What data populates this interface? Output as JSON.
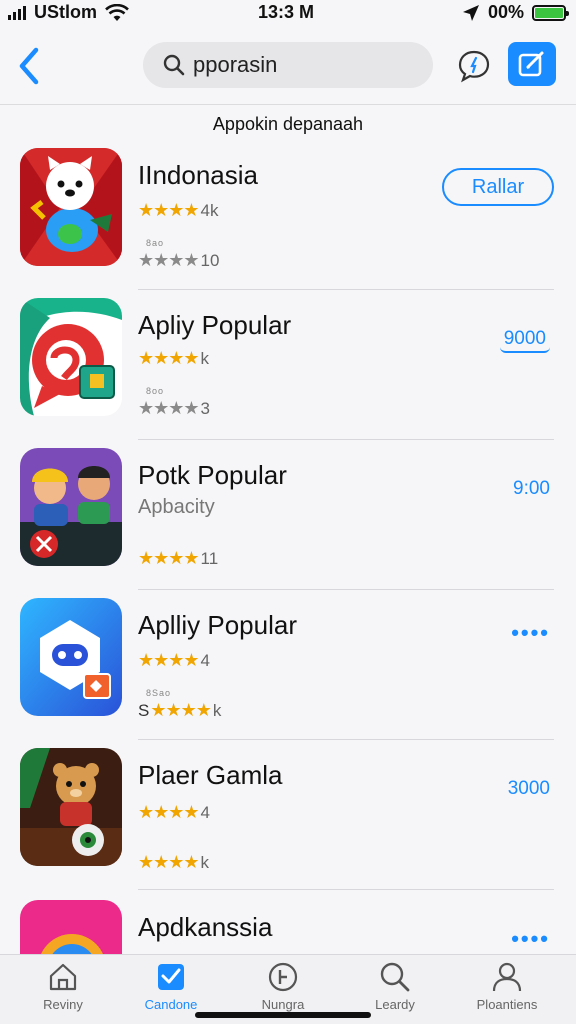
{
  "status_bar": {
    "carrier": "UStlom",
    "time": "13:3 M",
    "battery_pct": "00%"
  },
  "nav": {
    "search_query": "pporasin"
  },
  "section_title": "Appokin depanaah",
  "apps": [
    {
      "name": "IIndonasia",
      "stars_line1": "★★★★",
      "stars_line1_text": "4k",
      "tiny_text": "8ao",
      "stars_line2": "★★★★",
      "stars_line2_text": "10",
      "action": "Rallar",
      "action_style": "pill"
    },
    {
      "name": "Apliy Popular",
      "stars_line1": "★★★★",
      "stars_line1_text": "k",
      "tiny_text": "8oo",
      "stars_line2": "★★★★",
      "stars_line2_text": "3",
      "action": "9000",
      "action_style": "underline"
    },
    {
      "name": "Potk Popular",
      "subtitle": "Apbacity",
      "stars_line2": "★★★★",
      "stars_line2_text": "11",
      "action": "9:00",
      "action_style": "number"
    },
    {
      "name": "Aplliy Popular",
      "stars_line1": "★★★★",
      "stars_line1_text": "4",
      "tiny_text": "8Sao",
      "stars_line2": "★★★★",
      "stars_line2_prefix": "S",
      "stars_line2_text": "k",
      "action": "••••",
      "action_style": "dots"
    },
    {
      "name": "Plaer Gamla",
      "stars_line1": "★★★★",
      "stars_line1_text": "4",
      "stars_line2": "★★★★",
      "stars_line2_text": "k",
      "action": "3000",
      "action_style": "number"
    },
    {
      "name": "Apdkanssia",
      "action": "••••",
      "action_style": "dots"
    }
  ],
  "tabs": [
    {
      "label": "Reviny",
      "icon": "home-icon"
    },
    {
      "label": "Candone",
      "icon": "checkmark-box-icon",
      "active": true
    },
    {
      "label": "Nungra",
      "icon": "clock-icon"
    },
    {
      "label": "Leardy",
      "icon": "search-icon"
    },
    {
      "label": "Ploantiens",
      "icon": "person-icon"
    }
  ],
  "colors": {
    "accent": "#1a8cff",
    "star": "#f0a500",
    "battery": "#3bc43f"
  }
}
